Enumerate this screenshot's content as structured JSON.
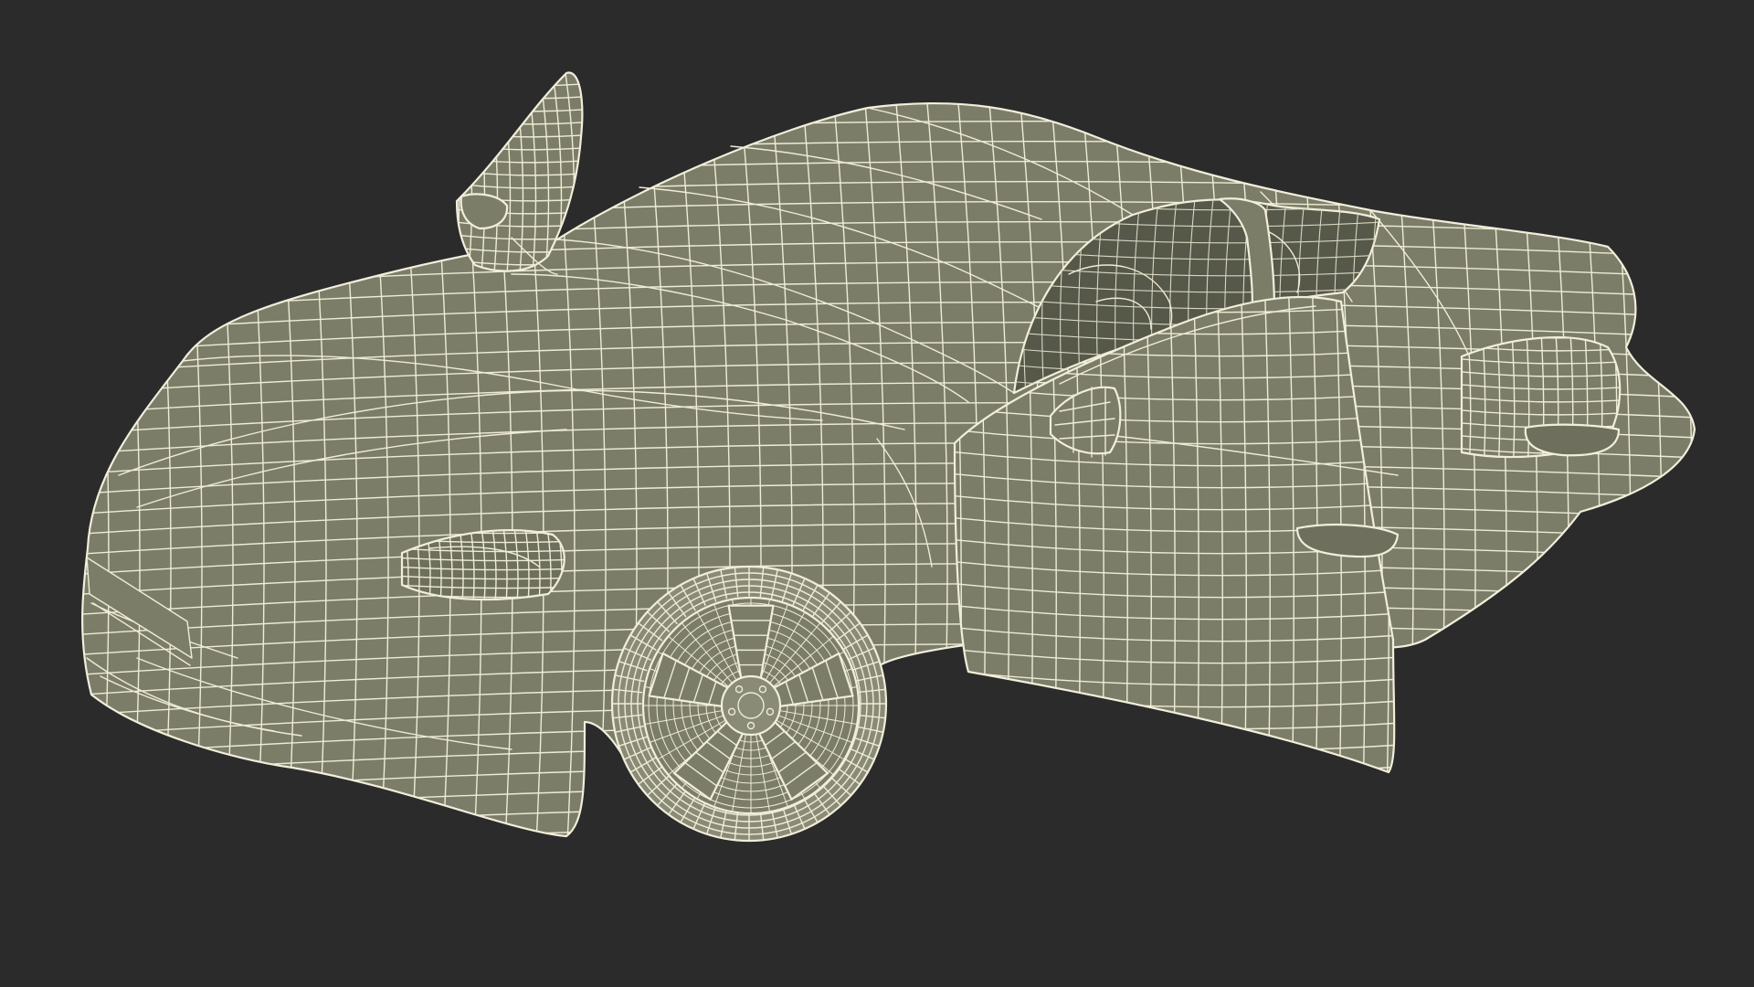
{
  "scene": {
    "subject": "wireframe-sports-car",
    "background_color": "#2b2b2b",
    "surface_color": "#7c7d68",
    "surface_dark_color": "#6e705d",
    "cabin_color": "#565849",
    "tire_color": "#8a8b77",
    "wire_color": "#efecd6",
    "state": {
      "driver_door": "open",
      "mirror_flap": "raised"
    }
  }
}
